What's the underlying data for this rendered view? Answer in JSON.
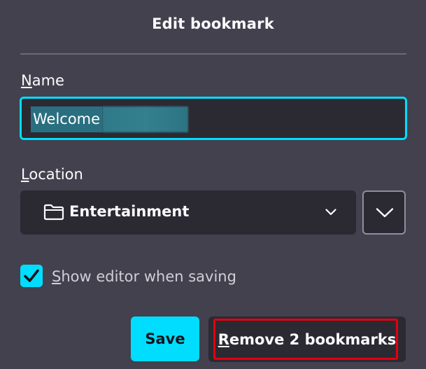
{
  "dialog": {
    "title": "Edit bookmark"
  },
  "name_field": {
    "label_accesskey": "N",
    "label_rest": "ame",
    "value": "Welcome"
  },
  "location_field": {
    "label_accesskey": "L",
    "label_rest": "ocation",
    "selected": "Entertainment",
    "folder_icon": "folder-icon",
    "chevron_icon": "chevron-down-icon"
  },
  "show_editor": {
    "checked": true,
    "label_accesskey": "S",
    "label_rest": "how editor when saving"
  },
  "buttons": {
    "save_label": "Save",
    "remove_accesskey": "R",
    "remove_rest": "emove 2 bookmarks"
  },
  "colors": {
    "background": "#42414d",
    "field": "#2b2a33",
    "accent": "#00ddff",
    "highlight": "#e3000f"
  }
}
